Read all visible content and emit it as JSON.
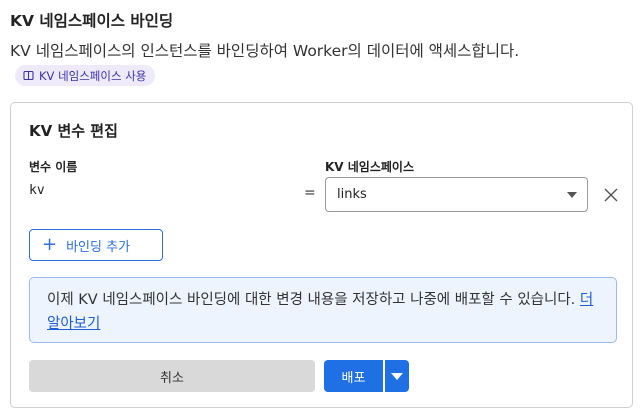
{
  "section": {
    "title": "KV 네임스페이스 바인딩",
    "description": "KV 네임스페이스의 인스턴스를 바인딩하여 Worker의 데이터에 액세스합니다.",
    "doc_pill_label": "KV 네임스페이스 사용",
    "doc_pill_icon": "book-icon"
  },
  "card": {
    "title": "KV 변수 편집",
    "variable_label": "변수 이름",
    "namespace_label": "KV 네임스페이스",
    "variable_value": "kv",
    "equals": "=",
    "namespace_value": "links",
    "add_binding_label": "바인딩 추가",
    "info_text": "이제 KV 네임스페이스 바인딩에 대한 변경 내용을 저장하고 나중에 배포할 수 있습니다. ",
    "info_link": "더 알아보기",
    "cancel_label": "취소",
    "deploy_label": "배포"
  },
  "colors": {
    "accent": "#1f6fe5",
    "info_bg": "#eef4fd",
    "pill_bg": "#eeeaf9",
    "pill_text": "#3b32a8"
  }
}
